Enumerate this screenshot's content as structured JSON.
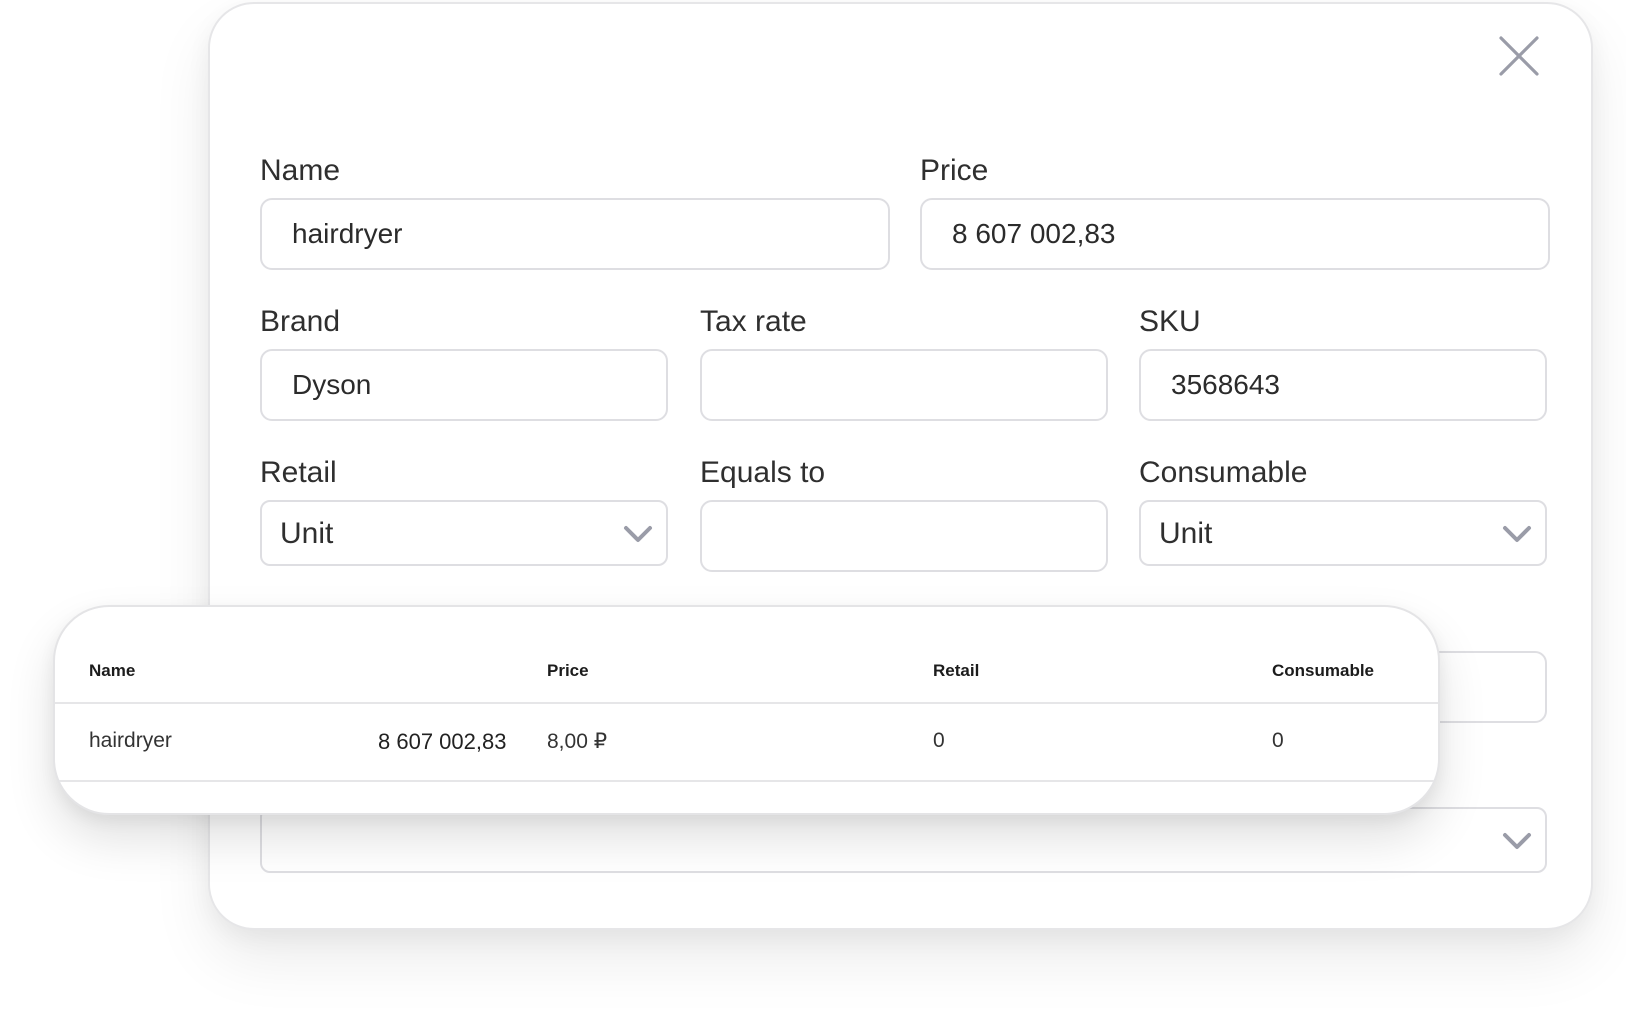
{
  "form": {
    "name_label": "Name",
    "name_value": "hairdryer",
    "price_label": "Price",
    "price_value": "8 607 002,83",
    "brand_label": "Brand",
    "brand_value": "Dyson",
    "tax_rate_label": "Tax rate",
    "tax_rate_value": "",
    "sku_label": "SKU",
    "sku_value": "3568643",
    "retail_label": "Retail",
    "retail_selected": "Unit",
    "equals_to_label": "Equals to",
    "equals_to_value": "",
    "consumable_label": "Consumable",
    "consumable_selected": "Unit",
    "hidden_select_value": ""
  },
  "icons": {
    "close": "close-icon",
    "dropdown": "chevron-down-icon"
  },
  "table": {
    "columns": [
      "Name",
      "Price",
      "Retail",
      "Consumable"
    ],
    "rows": [
      {
        "name": "hairdryer",
        "amount": "8 607 002,83",
        "price": "8,00 ₽",
        "retail": "0",
        "consumable": "0"
      }
    ]
  },
  "colors": {
    "border": "#dedee2",
    "text": "#2f2f2f",
    "icon": "#9a9ca8"
  }
}
